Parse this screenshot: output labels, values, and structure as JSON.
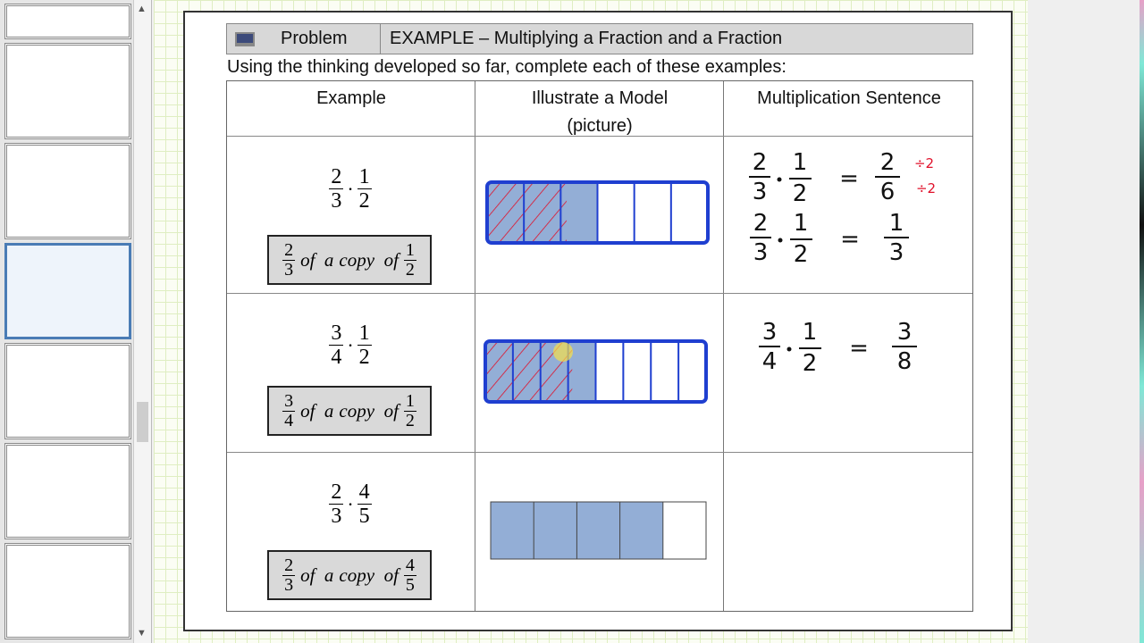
{
  "header": {
    "icon": "computer-icon",
    "label": "Problem",
    "title": "EXAMPLE –  Multiplying a Fraction and a Fraction"
  },
  "instruction": "Using the thinking developed so far, complete each of these examples:",
  "table": {
    "columns": [
      "Example",
      "Illustrate a Model\n(picture)",
      "Multiplication Sentence"
    ],
    "rows": [
      {
        "a": {
          "n": "2",
          "d": "3"
        },
        "b": {
          "n": "1",
          "d": "2"
        },
        "of": "of  a",
        "copy": "copy  of"
      },
      {
        "a": {
          "n": "3",
          "d": "4"
        },
        "b": {
          "n": "1",
          "d": "2"
        },
        "of": "of  a",
        "copy": "copy  of"
      },
      {
        "a": {
          "n": "2",
          "d": "3"
        },
        "b": {
          "n": "4",
          "d": "5"
        },
        "of": "of  a",
        "copy": "copy  of"
      }
    ]
  },
  "models": [
    {
      "parts": 6,
      "shaded": 3,
      "hatched": 2
    },
    {
      "parts": 8,
      "shaded": 4,
      "hatched": 3
    },
    {
      "parts": 5,
      "shaded": 4,
      "hatched": 0
    }
  ],
  "handwriting": {
    "s1": {
      "a_n": "2",
      "a_d": "3",
      "b_n": "1",
      "b_d": "2",
      "eq": "=",
      "r_n": "2",
      "r_d": "6",
      "div": "÷2"
    },
    "s2": {
      "a_n": "2",
      "a_d": "3",
      "b_n": "1",
      "b_d": "2",
      "eq": "=",
      "r_n": "1",
      "r_d": "3"
    },
    "s3": {
      "a_n": "3",
      "a_d": "4",
      "b_n": "1",
      "b_d": "2",
      "eq": "=",
      "r_n": "3",
      "r_d": "8"
    }
  },
  "colors": {
    "model_fill": "#93aed6",
    "outline": "#1f3fd0",
    "hatch": "#e0102a",
    "grid": "#dfeec2",
    "selected_thumb": "#4a7cb5"
  }
}
